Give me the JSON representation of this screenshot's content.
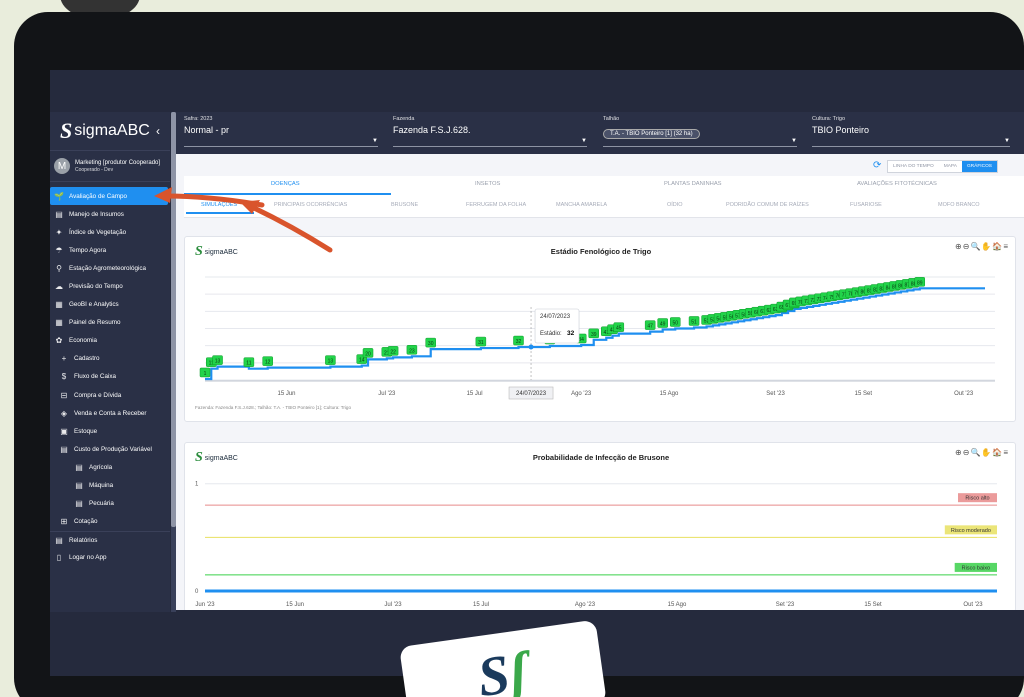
{
  "app": {
    "logo_text": "sigmaABC",
    "back_label": "‹",
    "user": {
      "initial": "M",
      "name": "Marketing [produtor Cooperado]",
      "role": "Cooperado - Dev"
    }
  },
  "sidebar": {
    "items": [
      {
        "icon": "🌱",
        "label": "Avaliação de Campo",
        "active": true,
        "level": 0
      },
      {
        "icon": "▤",
        "label": "Manejo de Insumos",
        "level": 0
      },
      {
        "icon": "✦",
        "label": "Índice de Vegetação",
        "level": 0
      },
      {
        "icon": "☂",
        "label": "Tempo Agora",
        "level": 0
      },
      {
        "icon": "⚲",
        "label": "Estação Agrometeorológica",
        "level": 0
      },
      {
        "icon": "☁",
        "label": "Previsão do Tempo",
        "level": 0
      },
      {
        "icon": "▦",
        "label": "GeoBI e Analytics",
        "level": 0
      },
      {
        "icon": "▦",
        "label": "Painel de Resumo",
        "level": 0
      },
      {
        "icon": "✿",
        "label": "Economia",
        "level": 0
      },
      {
        "icon": "+",
        "label": "Cadastro",
        "level": 1
      },
      {
        "icon": "$",
        "label": "Fluxo de Caixa",
        "level": 1
      },
      {
        "icon": "⊟",
        "label": "Compra e Dívida",
        "level": 1
      },
      {
        "icon": "◈",
        "label": "Venda e Conta a Receber",
        "level": 1
      },
      {
        "icon": "▣",
        "label": "Estoque",
        "level": 1
      },
      {
        "icon": "▤",
        "label": "Custo de Produção Variável",
        "level": 1
      },
      {
        "icon": "▤",
        "label": "Agrícola",
        "level": 2
      },
      {
        "icon": "▤",
        "label": "Máquina",
        "level": 2
      },
      {
        "icon": "▤",
        "label": "Pecuária",
        "level": 2
      },
      {
        "icon": "⊞",
        "label": "Cotação",
        "level": 1
      },
      {
        "icon": "▤",
        "label": "Relatórios",
        "level": 0,
        "sep": true
      },
      {
        "icon": "▯",
        "label": "Logar no App",
        "level": 0
      }
    ]
  },
  "filters": {
    "safra": {
      "label": "Safra: 2023",
      "value": "Normal - pr"
    },
    "fazenda": {
      "label": "Fazenda",
      "value": "Fazenda F.S.J.628."
    },
    "talhao": {
      "label": "Talhão",
      "chip": "T.A. - TBIO Ponteiro [1] (32 ha)"
    },
    "cultura": {
      "label": "Cultura: Trigo",
      "value": "TBIO Ponteiro"
    }
  },
  "toolbar": {
    "views": [
      "LINHA DO TEMPO",
      "MAPA",
      "GRÁFICOS"
    ],
    "active_view": "GRÁFICOS"
  },
  "tabs": {
    "primary": [
      "DOENÇAS",
      "INSETOS",
      "PLANTAS DANINHAS",
      "AVALIAÇÕES FITOTÉCNICAS"
    ],
    "secondary": [
      "SIMULAÇÕES",
      "PRINCIPAIS OCORRÊNCIAS",
      "BRUSONE",
      "FERRUGEM DA FOLHA",
      "MANCHA AMARELA",
      "OÍDIO",
      "PODRIDÃO COMUM DE RAÍZES",
      "FUSARIOSE",
      "MOFO BRANCO"
    ]
  },
  "chart1": {
    "brand": "sigmaABC",
    "tools": "⊕⊖🔍✋🏠≡",
    "footer": "Fazenda: Fazenda F.S.J.628.; Talhão: T.A. - TBIO Ponteiro [1]; Cultura: Trigo",
    "tooltip": {
      "date": "24/07/2023",
      "label": "Estádio:",
      "value": "32"
    },
    "axis_highlight": "24/07/2023"
  },
  "chart2": {
    "brand": "sigmaABC",
    "tools": "⊕⊖🔍✋🏠≡",
    "risk_labels": {
      "alto": "Risco alto",
      "moderado": "Risco moderado",
      "baixo": "Risco baixo"
    }
  },
  "chart_data": [
    {
      "type": "line",
      "title": "Estádio Fenológico de Trigo",
      "x_ticks": [
        "15 Jun",
        "Jul '23",
        "15 Jul",
        "Ago '23",
        "15 Ago",
        "Set '23",
        "15 Set",
        "Out '23"
      ],
      "x_range": [
        "2023-06-02",
        "2023-10-06"
      ],
      "ylim": [
        0,
        100
      ],
      "series": [
        {
          "labels": [
            {
              "x": "2023-06-02",
              "y": 1
            },
            {
              "x": "2023-06-03",
              "y": 11
            },
            {
              "x": "2023-06-04",
              "y": 13
            },
            {
              "x": "2023-06-09",
              "y": 11
            },
            {
              "x": "2023-06-12",
              "y": 12
            },
            {
              "x": "2023-06-22",
              "y": 13
            },
            {
              "x": "2023-06-27",
              "y": 14
            },
            {
              "x": "2023-06-28",
              "y": 20
            },
            {
              "x": "2023-07-01",
              "y": 21
            },
            {
              "x": "2023-07-02",
              "y": 22
            },
            {
              "x": "2023-07-05",
              "y": 23
            },
            {
              "x": "2023-07-08",
              "y": 30
            },
            {
              "x": "2023-07-16",
              "y": 31
            },
            {
              "x": "2023-07-22",
              "y": 32
            },
            {
              "x": "2023-07-27",
              "y": 33
            },
            {
              "x": "2023-08-01",
              "y": 34
            },
            {
              "x": "2023-08-03",
              "y": 39
            },
            {
              "x": "2023-08-05",
              "y": 41
            },
            {
              "x": "2023-08-06",
              "y": 43
            },
            {
              "x": "2023-08-07",
              "y": 45
            },
            {
              "x": "2023-08-12",
              "y": 47
            },
            {
              "x": "2023-08-14",
              "y": 49
            },
            {
              "x": "2023-08-16",
              "y": 50
            },
            {
              "x": "2023-08-19",
              "y": 51
            },
            {
              "x": "2023-08-21",
              "y": 52
            },
            {
              "x": "2023-08-22",
              "y": 53
            },
            {
              "x": "2023-08-23",
              "y": 54
            },
            {
              "x": "2023-08-24",
              "y": 55
            },
            {
              "x": "2023-08-25",
              "y": 56
            },
            {
              "x": "2023-08-26",
              "y": 57
            },
            {
              "x": "2023-08-27",
              "y": 58
            },
            {
              "x": "2023-08-28",
              "y": 59
            },
            {
              "x": "2023-08-29",
              "y": 60
            },
            {
              "x": "2023-08-30",
              "y": 61
            },
            {
              "x": "2023-08-31",
              "y": 62
            },
            {
              "x": "2023-09-01",
              "y": 63
            },
            {
              "x": "2023-09-02",
              "y": 64
            },
            {
              "x": "2023-09-02",
              "y": 65
            },
            {
              "x": "2023-09-03",
              "y": 66
            },
            {
              "x": "2023-09-03",
              "y": 67
            },
            {
              "x": "2023-09-04",
              "y": 68
            },
            {
              "x": "2023-09-04",
              "y": 69
            },
            {
              "x": "2023-09-05",
              "y": 70
            },
            {
              "x": "2023-09-06",
              "y": 71
            },
            {
              "x": "2023-09-07",
              "y": 72
            },
            {
              "x": "2023-09-08",
              "y": 73
            },
            {
              "x": "2023-09-09",
              "y": 74
            },
            {
              "x": "2023-09-10",
              "y": 75
            },
            {
              "x": "2023-09-11",
              "y": 76
            },
            {
              "x": "2023-09-12",
              "y": 77
            },
            {
              "x": "2023-09-13",
              "y": 78
            },
            {
              "x": "2023-09-14",
              "y": 79
            },
            {
              "x": "2023-09-15",
              "y": 80
            },
            {
              "x": "2023-09-16",
              "y": 81
            },
            {
              "x": "2023-09-17",
              "y": 82
            },
            {
              "x": "2023-09-18",
              "y": 83
            },
            {
              "x": "2023-09-19",
              "y": 84
            },
            {
              "x": "2023-09-20",
              "y": 85
            },
            {
              "x": "2023-09-21",
              "y": 86
            },
            {
              "x": "2023-09-22",
              "y": 87
            },
            {
              "x": "2023-09-23",
              "y": 88
            },
            {
              "x": "2023-09-24",
              "y": 89
            }
          ],
          "color": "#1f8ff0"
        }
      ]
    },
    {
      "type": "line",
      "title": "Probabilidade de Infecção de Brusone",
      "x_ticks": [
        "Jun '23",
        "15 Jun",
        "Jul '23",
        "15 Jul",
        "Ago '23",
        "15 Ago",
        "Set '23",
        "15 Set",
        "Out '23"
      ],
      "y_ticks": [
        "0",
        "1"
      ],
      "ylim": [
        0,
        1.1
      ],
      "thresholds": [
        {
          "name": "Risco alto",
          "y": 0.8,
          "color": "#e88a8a"
        },
        {
          "name": "Risco moderado",
          "y": 0.5,
          "color": "#e8e060"
        },
        {
          "name": "Risco baixo",
          "y": 0.15,
          "color": "#3ad04a"
        }
      ],
      "series": [
        {
          "values_constant": 0,
          "color": "#1f8ff0"
        }
      ]
    }
  ]
}
